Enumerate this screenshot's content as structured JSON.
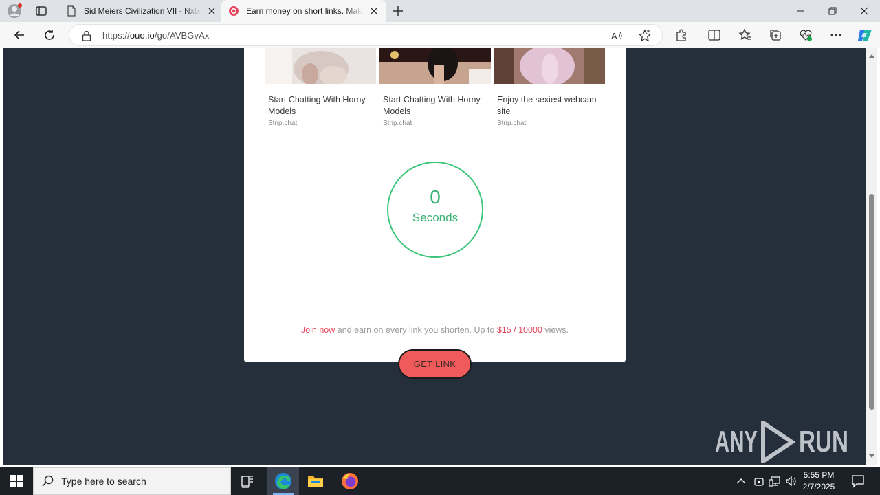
{
  "browser": {
    "tabs": [
      {
        "title": "Sid Meiers Civilization VII - Nxbrew",
        "active": false
      },
      {
        "title": "Earn money on short links. Make",
        "active": true
      }
    ],
    "url_prefix": "https://",
    "url_domain": "ouo.io",
    "url_path": "/go/AVBGvAx"
  },
  "ads": [
    {
      "title": "Start Chatting With Horny Models",
      "source": "Strip.chat"
    },
    {
      "title": "Start Chatting With Horny Models",
      "source": "Strip.chat"
    },
    {
      "title": "Enjoy the sexiest webcam site",
      "source": "Strip.chat"
    }
  ],
  "timer": {
    "value": "0",
    "unit": "Seconds"
  },
  "promo": {
    "join": "Join now",
    "middle": " and earn on every link you shorten. Up to ",
    "rate": "$15 / 10000",
    "end": " views."
  },
  "get_link_label": "GET LINK",
  "watermark": "ANY RUN",
  "taskbar": {
    "search_placeholder": "Type here to search",
    "time": "5:55 PM",
    "date": "2/7/2025"
  },
  "colors": {
    "page_bg": "#252f3b",
    "timer_green": "#3bc47a",
    "accent_red": "#e4475b",
    "button_red": "#ef5b5b"
  }
}
